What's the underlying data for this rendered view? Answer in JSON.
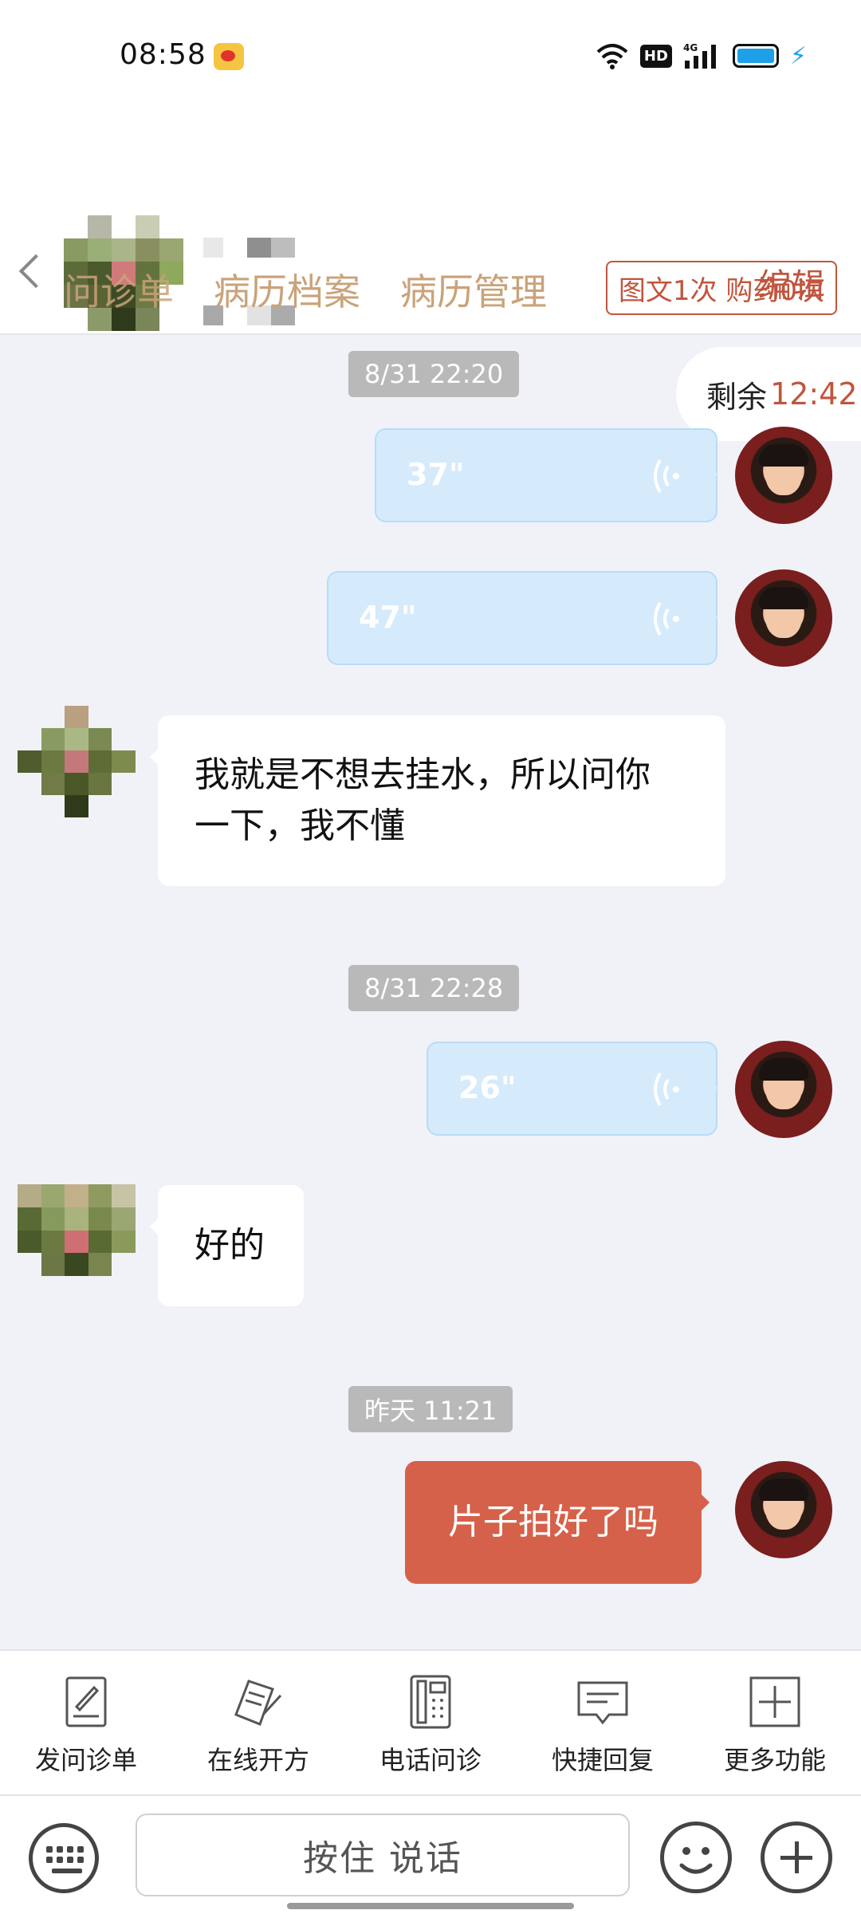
{
  "status_bar": {
    "time": "08:58",
    "network": "4G",
    "hd_badge": "HD"
  },
  "header": {
    "edit_label": "编辑",
    "tabs": [
      {
        "label": "问诊单"
      },
      {
        "label": "病历档案"
      },
      {
        "label": "病历管理"
      }
    ],
    "quota_label": "图文1次 购药0次"
  },
  "remaining": {
    "label": "剩余",
    "value": "12:42"
  },
  "messages": [
    {
      "type": "time",
      "text": "8/31 22:20"
    },
    {
      "type": "voice",
      "side": "right",
      "duration": "37\""
    },
    {
      "type": "voice",
      "side": "right",
      "duration": "47\""
    },
    {
      "type": "text",
      "side": "left",
      "text_line1": "我就是不想去挂水，所以问你",
      "text_line2": "一下，我不懂"
    },
    {
      "type": "time",
      "text": "8/31 22:28"
    },
    {
      "type": "voice",
      "side": "right",
      "duration": "26\""
    },
    {
      "type": "text",
      "side": "left",
      "text": "好的"
    },
    {
      "type": "time",
      "text": "昨天 11:21"
    },
    {
      "type": "text",
      "side": "right",
      "text": "片子拍好了吗"
    }
  ],
  "toolbar": {
    "items": [
      {
        "label": "发问诊单",
        "icon": "form-pen-icon"
      },
      {
        "label": "在线开方",
        "icon": "prescription-icon"
      },
      {
        "label": "电话问诊",
        "icon": "phone-icon"
      },
      {
        "label": "快捷回复",
        "icon": "quick-reply-icon"
      },
      {
        "label": "更多功能",
        "icon": "more-plus-icon"
      }
    ]
  },
  "input_bar": {
    "talk_label": "按住 说话"
  },
  "colors": {
    "accent": "#c0553d",
    "sent_bubble": "#d6614a",
    "voice_bubble": "#d5ebfc",
    "tab_text": "#c9a37a"
  }
}
